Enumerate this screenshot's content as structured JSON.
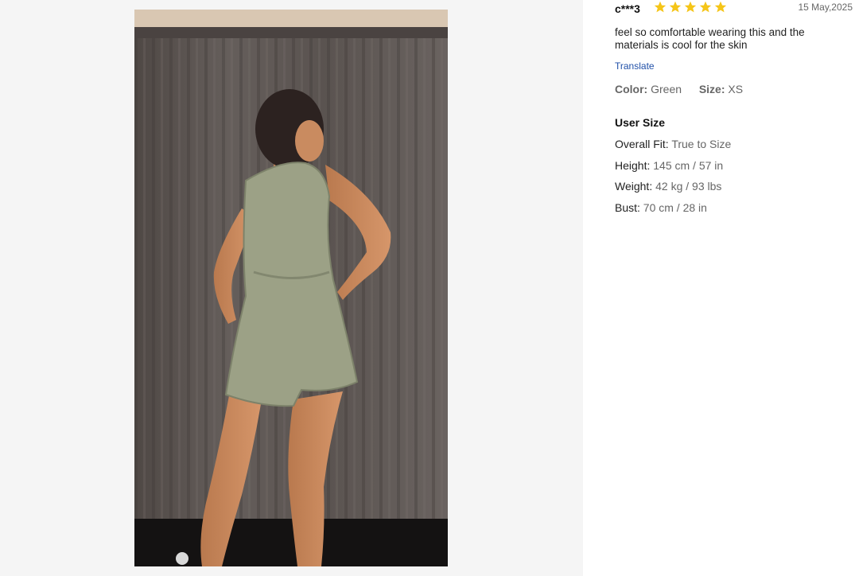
{
  "review": {
    "user": "c***3",
    "rating": 5,
    "date": "15 May,2025",
    "text": "feel so comfortable wearing this and the materials is cool for the skin",
    "translate_label": "Translate",
    "color_label": "Color:",
    "color_value": "Green",
    "size_label": "Size:",
    "size_value": "XS"
  },
  "user_size": {
    "title": "User Size",
    "rows": [
      {
        "label": "Overall Fit:",
        "value": "True to Size"
      },
      {
        "label": "Height:",
        "value": "145 cm / 57 in"
      },
      {
        "label": "Weight:",
        "value": "42 kg / 93 lbs"
      },
      {
        "label": "Bust:",
        "value": "70 cm / 28 in"
      }
    ]
  },
  "colors": {
    "star": "#f5c518",
    "link": "#2050a8",
    "romper": "#9ca186",
    "curtain": "#5d5654"
  },
  "icons": {
    "star": "star-icon"
  }
}
